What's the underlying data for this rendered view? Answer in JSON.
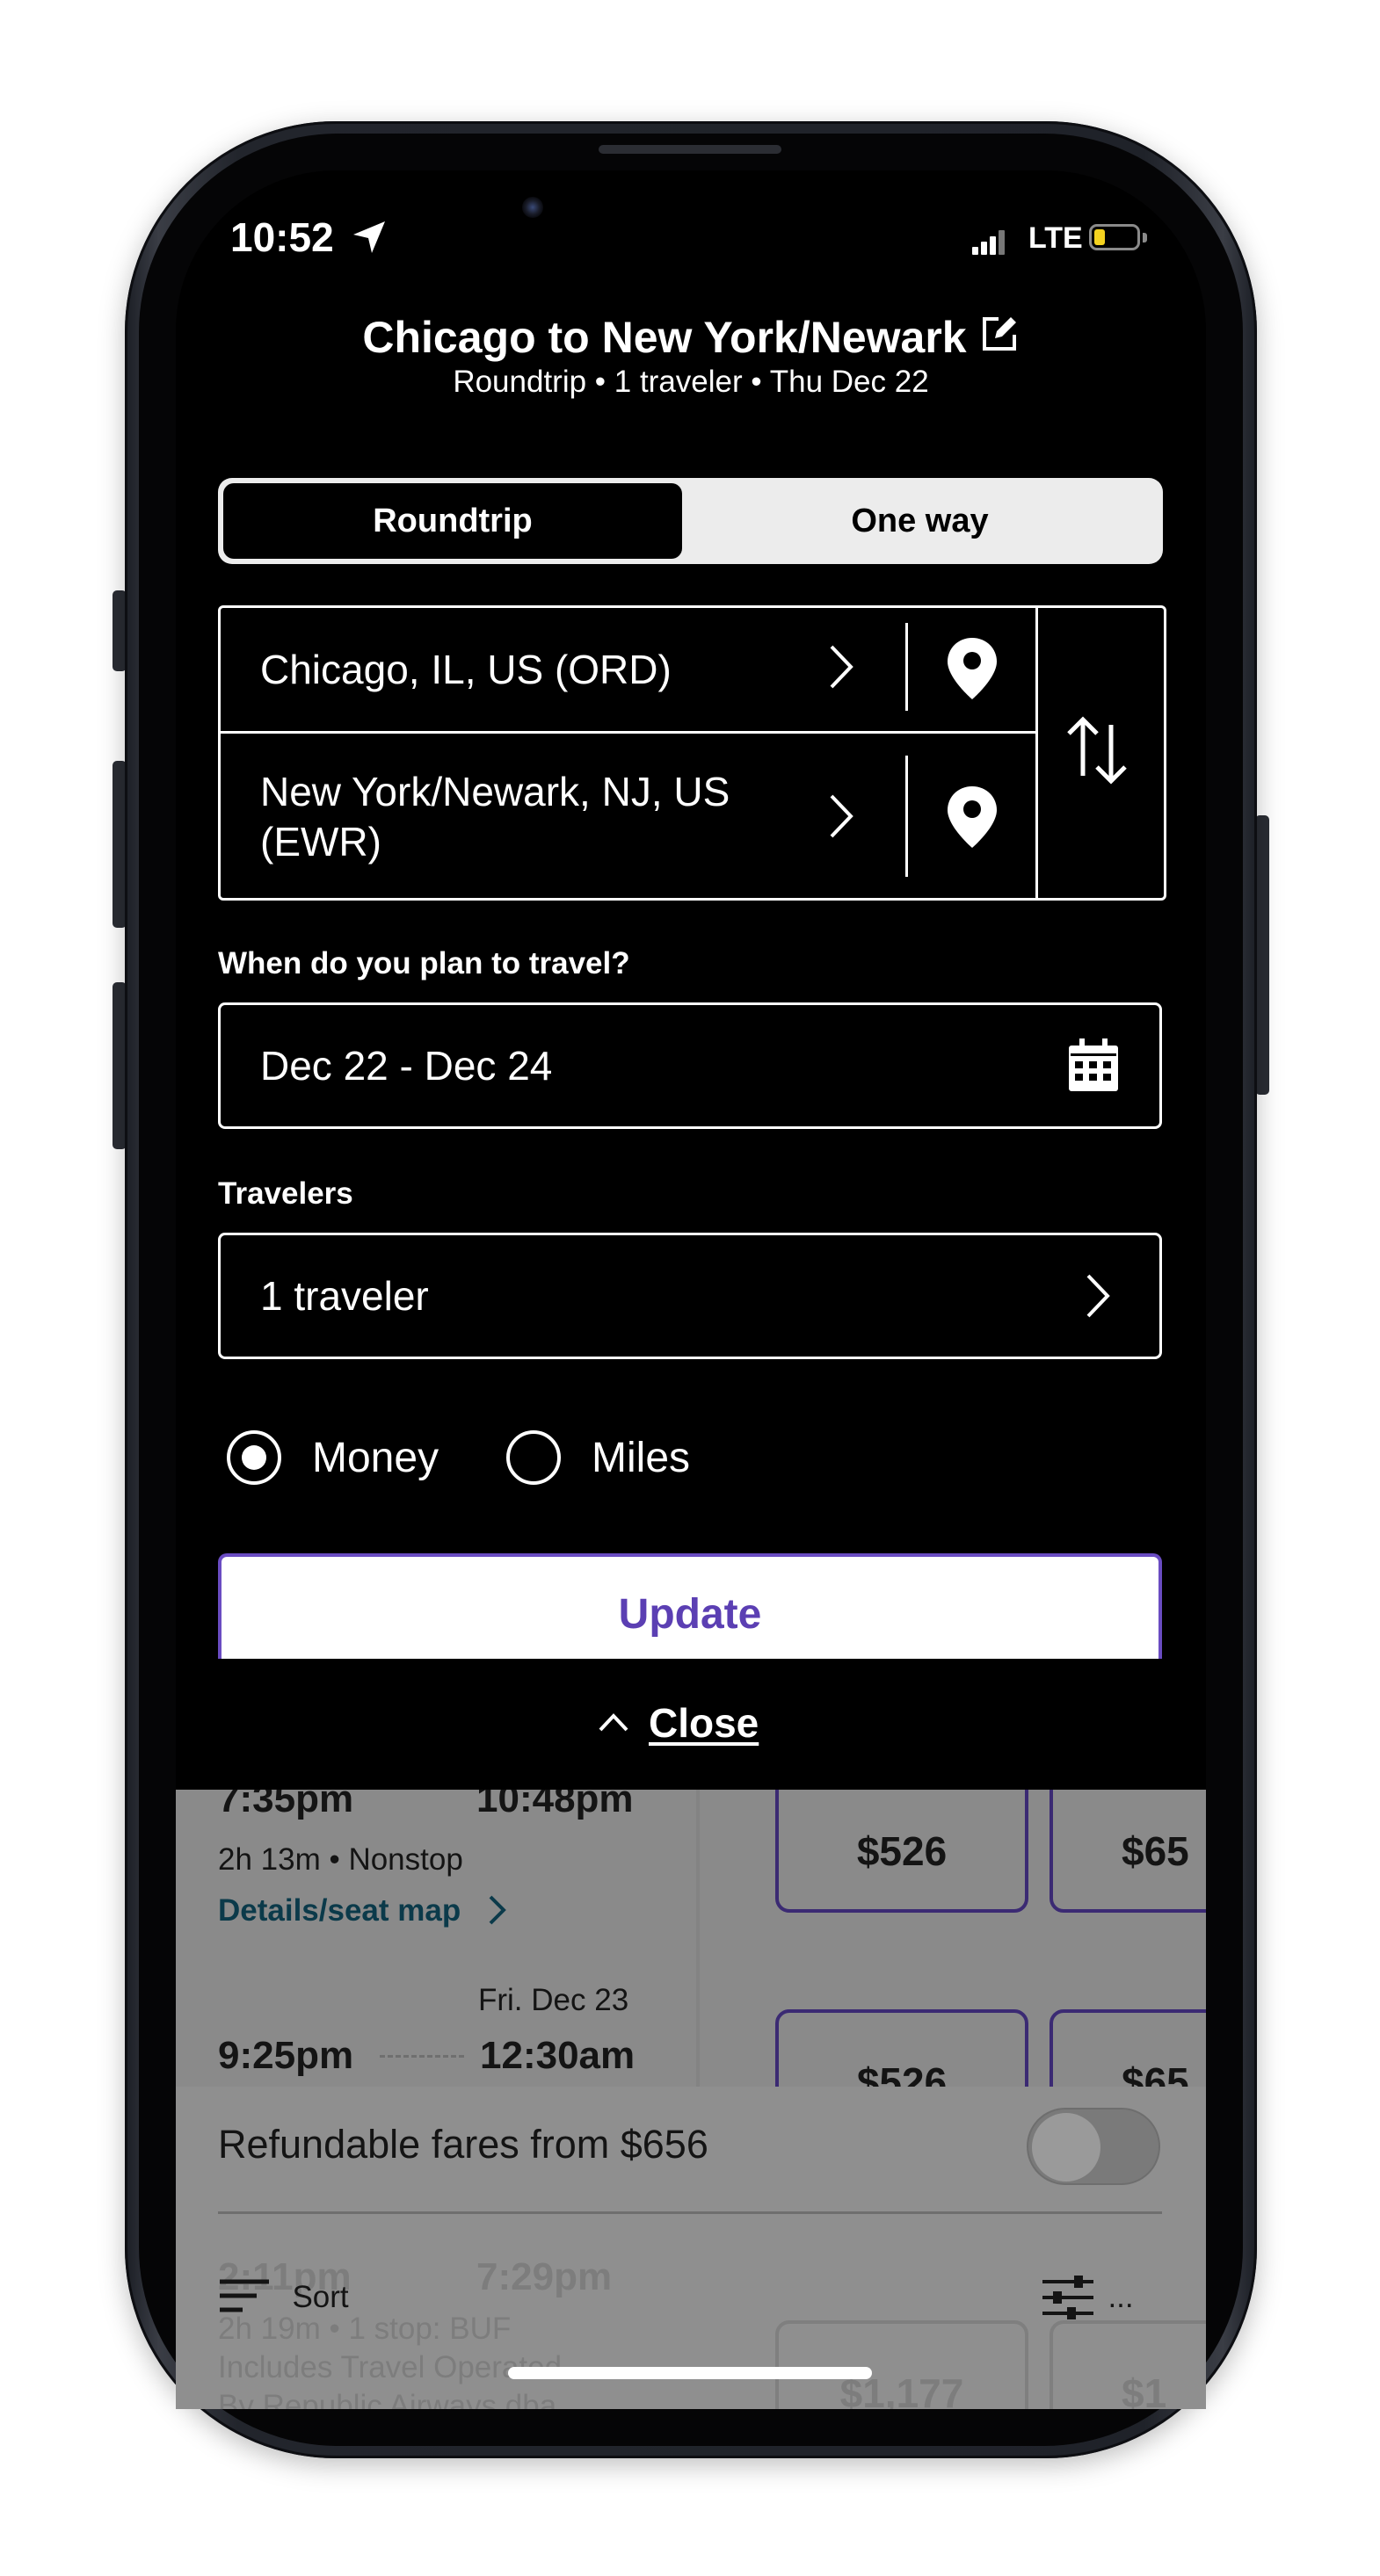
{
  "status_bar": {
    "time": "10:52",
    "network": "LTE"
  },
  "header": {
    "title": "Chicago to New York/Newark",
    "subtitle": "Roundtrip • 1 traveler • Thu Dec 22"
  },
  "trip_type": {
    "options": [
      "Roundtrip",
      "One way"
    ],
    "selected": "Roundtrip"
  },
  "route": {
    "origin": "Chicago, IL, US (ORD)",
    "destination": "New York/Newark, NJ, US (EWR)"
  },
  "dates": {
    "label": "When do you plan to travel?",
    "value": "Dec 22 - Dec 24"
  },
  "travelers": {
    "label": "Travelers",
    "value": "1 traveler"
  },
  "payment": {
    "options": [
      "Money",
      "Miles"
    ],
    "selected": "Money"
  },
  "update_label": "Update",
  "close_label": "Close",
  "results": {
    "flights": [
      {
        "depart": "7:35pm",
        "arrive": "10:48pm",
        "duration": "2h 13m • Nonstop",
        "details": "Details/seat map",
        "fare1": "$526",
        "fare2": "$65"
      },
      {
        "arrive_date": "Fri. Dec 23",
        "depart": "9:25pm",
        "arrive": "12:30am",
        "fare1": "$526",
        "fare2": "$65"
      },
      {
        "depart": "2:11pm",
        "arrive": "7:29pm",
        "duration": "2h 19m • 1 stop: BUF",
        "note_line1": "Includes Travel Operated",
        "note_line2": "By Republic Airways dba",
        "fare1": "$1,177",
        "fare2": "$1"
      }
    ],
    "refundable_label": "Refundable fares from $656",
    "refundable_on": false,
    "sort_label": "Sort",
    "filter_label": "..."
  },
  "colors": {
    "accent": "#5b3fb3",
    "fare_border": "#3b2a73",
    "link": "#0b3a4a"
  }
}
